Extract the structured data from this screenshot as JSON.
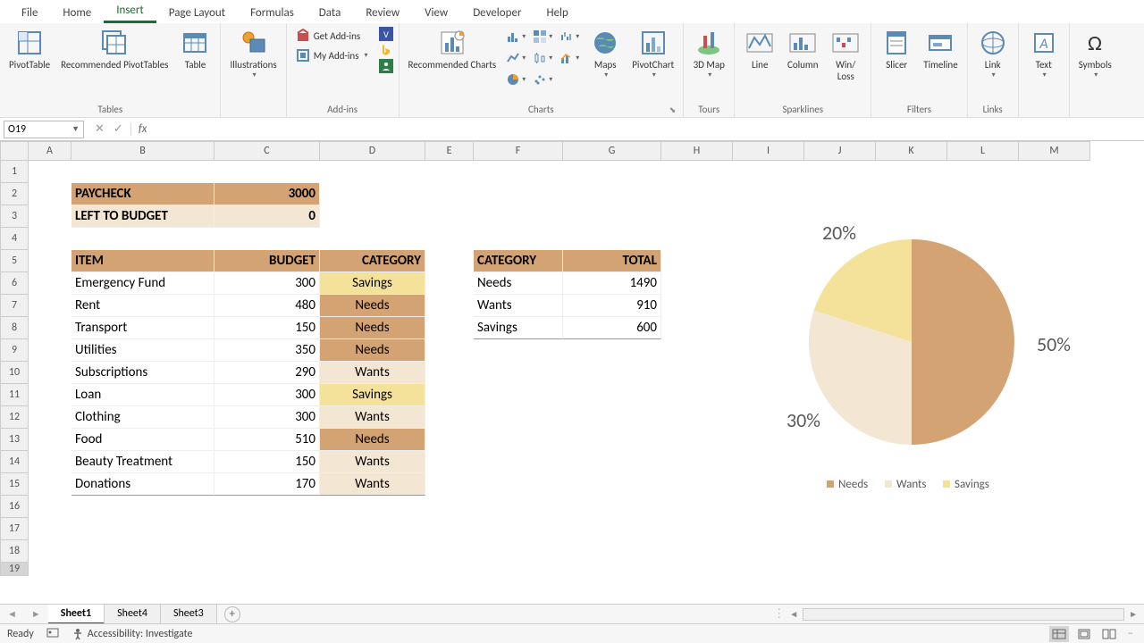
{
  "tabs": {
    "file": "File",
    "home": "Home",
    "insert": "Insert",
    "page_layout": "Page Layout",
    "formulas": "Formulas",
    "data": "Data",
    "review": "Review",
    "view": "View",
    "developer": "Developer",
    "help": "Help"
  },
  "ribbon": {
    "tables": {
      "pivot": "PivotTable",
      "rec_pivot": "Recommended PivotTables",
      "table": "Table",
      "label": "Tables"
    },
    "illus": {
      "btn": "Illustrations",
      "label": ""
    },
    "addins": {
      "get": "Get Add-ins",
      "my": "My Add-ins",
      "label": "Add-ins"
    },
    "charts": {
      "rec": "Recommended Charts",
      "maps": "Maps",
      "pivotchart": "PivotChart",
      "label": "Charts"
    },
    "tours": {
      "map3d": "3D Map",
      "label": "Tours"
    },
    "sparklines": {
      "line": "Line",
      "column": "Column",
      "winloss": "Win/\nLoss",
      "label": "Sparklines"
    },
    "filters": {
      "slicer": "Slicer",
      "timeline": "Timeline",
      "label": "Filters"
    },
    "links": {
      "link": "Link",
      "label": "Links"
    },
    "text": {
      "text": "Text",
      "label": ""
    },
    "symbols": {
      "sym": "Symbols",
      "label": ""
    }
  },
  "name_box": "O19",
  "formula": "",
  "col_widths": {
    "A": 48,
    "B": 160,
    "C": 118,
    "D": 118,
    "E": 54,
    "F": 100,
    "G": 110,
    "H": 80,
    "I": 80,
    "J": 80,
    "K": 80,
    "L": 80,
    "M": 80
  },
  "cols": [
    "A",
    "B",
    "C",
    "D",
    "E",
    "F",
    "G",
    "H",
    "I",
    "J",
    "K",
    "L",
    "M"
  ],
  "rows": 19,
  "paycheck": {
    "label": "PAYCHECK",
    "value": "3000"
  },
  "left": {
    "label": "LEFT TO BUDGET",
    "value": "0"
  },
  "table_headers": {
    "item": "ITEM",
    "budget": "BUDGET",
    "category": "CATEGORY"
  },
  "items": [
    {
      "item": "Emergency Fund",
      "budget": "300",
      "cat": "Savings",
      "cat_bg": "#f5e29a"
    },
    {
      "item": "Rent",
      "budget": "480",
      "cat": "Needs",
      "cat_bg": "#d4a373"
    },
    {
      "item": "Transport",
      "budget": "150",
      "cat": "Needs",
      "cat_bg": "#d4a373"
    },
    {
      "item": "Utilities",
      "budget": "350",
      "cat": "Needs",
      "cat_bg": "#d4a373"
    },
    {
      "item": "Subscriptions",
      "budget": "290",
      "cat": "Wants",
      "cat_bg": "#f3e7d3"
    },
    {
      "item": "Loan",
      "budget": "300",
      "cat": "Savings",
      "cat_bg": "#f5e29a"
    },
    {
      "item": "Clothing",
      "budget": "300",
      "cat": "Wants",
      "cat_bg": "#f3e7d3"
    },
    {
      "item": "Food",
      "budget": "510",
      "cat": "Needs",
      "cat_bg": "#d4a373"
    },
    {
      "item": "Beauty Treatment",
      "budget": "150",
      "cat": "Wants",
      "cat_bg": "#f3e7d3"
    },
    {
      "item": "Donations",
      "budget": "170",
      "cat": "Wants",
      "cat_bg": "#f3e7d3"
    }
  ],
  "summary_headers": {
    "category": "CATEGORY",
    "total": "TOTAL"
  },
  "summary": [
    {
      "cat": "Needs",
      "total": "1490"
    },
    {
      "cat": "Wants",
      "total": "910"
    },
    {
      "cat": "Savings",
      "total": "600"
    }
  ],
  "chart_data": {
    "type": "pie",
    "categories": [
      "Needs",
      "Wants",
      "Savings"
    ],
    "values": [
      50,
      30,
      20
    ],
    "labels": [
      "50%",
      "30%",
      "20%"
    ],
    "colors": [
      "#d4a373",
      "#f3e7d3",
      "#f5e29a"
    ],
    "legend": [
      "Needs",
      "Wants",
      "Savings"
    ]
  },
  "sheets": [
    "Sheet1",
    "Sheet4",
    "Sheet3"
  ],
  "active_sheet": 0,
  "status": {
    "ready": "Ready",
    "accessibility": "Accessibility: Investigate"
  }
}
